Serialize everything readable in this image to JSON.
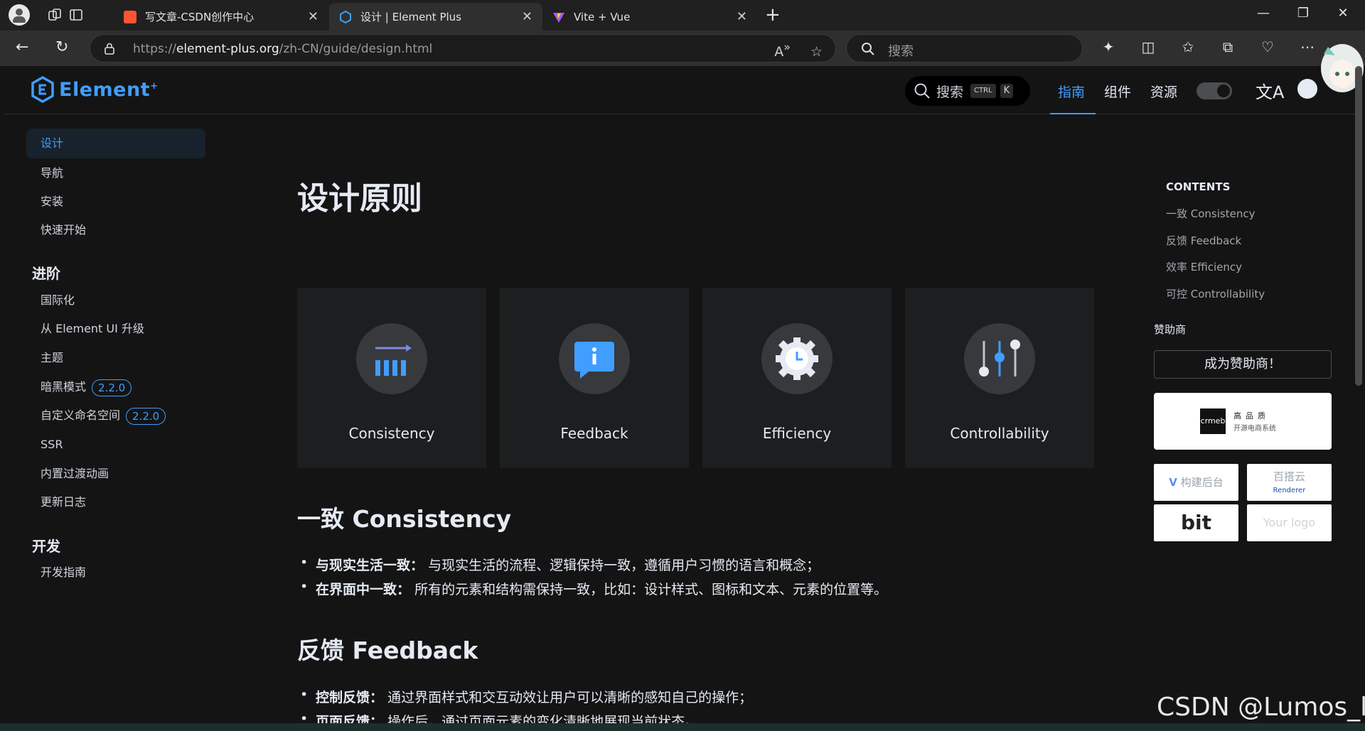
{
  "browser": {
    "tabs": [
      {
        "title": "写文章-CSDN创作中心",
        "favicon": "csdn-icon",
        "active": false
      },
      {
        "title": "设计 | Element Plus",
        "favicon": "element-plus-icon",
        "active": true
      },
      {
        "title": "Vite + Vue",
        "favicon": "vite-icon",
        "active": false
      }
    ],
    "url_prefix": "https://",
    "url_domain": "element-plus.org",
    "url_path": "/zh-CN/guide/design.html",
    "search_placeholder": "搜索"
  },
  "header": {
    "logo_text": "Element",
    "logo_sup": "+",
    "search_label": "搜索",
    "search_kbd_ctrl": "CTRL",
    "search_kbd_k": "K",
    "nav": [
      "指南",
      "组件",
      "资源"
    ],
    "active_nav": "指南",
    "lang_icon": "文A"
  },
  "sidebar": {
    "items_top": [
      "设计",
      "导航",
      "安装",
      "快速开始"
    ],
    "active_item": "设计",
    "group_advanced": "进阶",
    "items_advanced": [
      {
        "label": "国际化"
      },
      {
        "label": "从 Element UI 升级"
      },
      {
        "label": "主题"
      },
      {
        "label": "暗黑模式",
        "badge": "2.2.0"
      },
      {
        "label": "自定义命名空间",
        "badge": "2.2.0"
      },
      {
        "label": "SSR"
      },
      {
        "label": "内置过渡动画"
      },
      {
        "label": "更新日志"
      }
    ],
    "group_dev": "开发",
    "items_dev": [
      "开发指南"
    ]
  },
  "main": {
    "title": "设计原则",
    "cards": [
      "Consistency",
      "Feedback",
      "Efficiency",
      "Controllability"
    ],
    "section1": {
      "heading": "一致 Consistency",
      "bullets": [
        {
          "strong": "与现实生活一致：",
          "text": "与现实生活的流程、逻辑保持一致，遵循用户习惯的语言和概念；"
        },
        {
          "strong": "在界面中一致：",
          "text": "所有的元素和结构需保持一致，比如：设计样式、图标和文本、元素的位置等。"
        }
      ]
    },
    "section2": {
      "heading": "反馈 Feedback",
      "bullets": [
        {
          "strong": "控制反馈：",
          "text": "通过界面样式和交互动效让用户可以清晰的感知自己的操作；"
        },
        {
          "strong": "页面反馈：",
          "text": "操作后，通过页面元素的变化清晰地展现当前状态。"
        }
      ]
    }
  },
  "aside": {
    "toc_title": "CONTENTS",
    "toc": [
      "一致 Consistency",
      "反馈 Feedback",
      "效率 Efficiency",
      "可控 Controllability"
    ],
    "sponsor_title": "赞助商",
    "sponsor_button": "成为赞助商！",
    "sponsor_crmeb_logo": "crmeb",
    "sponsor_crmeb_line1": "高品质",
    "sponsor_crmeb_line2": "开源电商系统",
    "sponsor_vbuild": "构建后台",
    "sponsor_baidayun": "百搭云",
    "sponsor_renderer": "Renderer",
    "sponsor_bit": "bit",
    "sponsor_your_logo": "Your logo"
  },
  "watermark": "CSDN @Lumos_ll",
  "colors": {
    "accent": "#409eff",
    "background": "#141414",
    "card": "#1d1e1f"
  }
}
